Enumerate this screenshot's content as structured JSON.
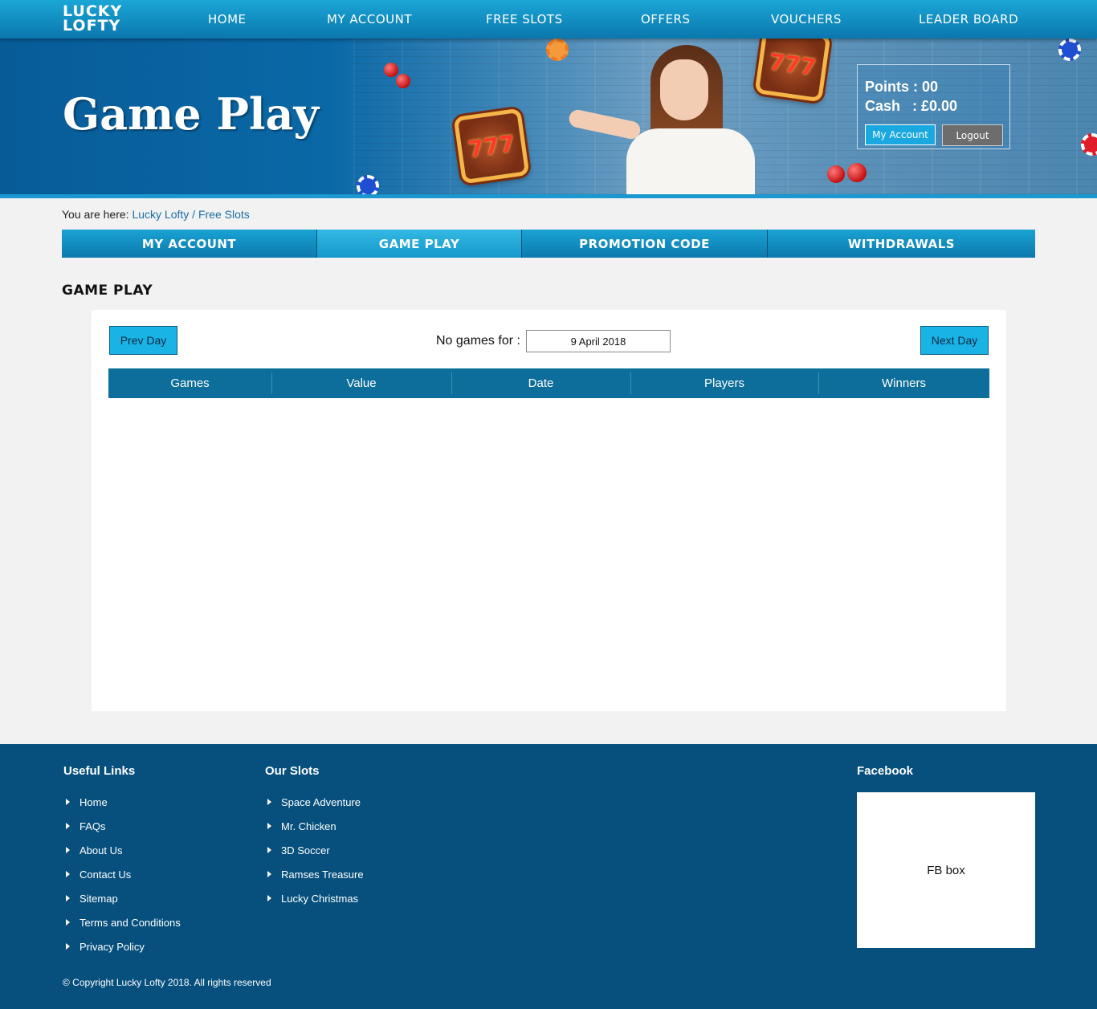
{
  "brand": {
    "logo_line1": "LUCKY",
    "logo_line2": "LOFTY"
  },
  "nav": [
    "HOME",
    "MY ACCOUNT",
    "FREE SLOTS",
    "OFFERS",
    "VOUCHERS",
    "LEADER BOARD"
  ],
  "hero": {
    "title": "Game Play",
    "slot_symbol": "777"
  },
  "account": {
    "points_label": "Points : 00",
    "cash_label": "Cash   : £0.00",
    "my_account_button": "My Account",
    "logout_button": "Logout"
  },
  "breadcrumb": {
    "prefix": "You are here:",
    "items": [
      "Lucky Lofty",
      "Free Slots"
    ],
    "separator": "/"
  },
  "subtabs": [
    {
      "label": "MY ACCOUNT",
      "active": false
    },
    {
      "label": "GAME PLAY",
      "active": true
    },
    {
      "label": "PROMOTION CODE",
      "active": false
    },
    {
      "label": "WITHDRAWALS",
      "active": false
    }
  ],
  "section_title": "GAME PLAY",
  "gameplay": {
    "prev_button": "Prev Day",
    "next_button": "Next Day",
    "no_games_label": "No games for :",
    "date_value": "9 April 2018",
    "columns": [
      "Games",
      "Value",
      "Date",
      "Players",
      "Winners"
    ]
  },
  "footer": {
    "useful_links_title": "Useful Links",
    "useful_links": [
      "Home",
      "FAQs",
      "About Us",
      "Contact Us",
      "Sitemap",
      "Terms and Conditions",
      "Privacy Policy"
    ],
    "our_slots_title": "Our Slots",
    "our_slots": [
      "Space Adventure",
      "Mr. Chicken",
      "3D Soccer",
      "Ramses Treasure",
      "Lucky Christmas"
    ],
    "facebook_title": "Facebook",
    "fb_box": "FB box",
    "copyright": "© Copyright Lucky Lofty 2018. All rights reserved"
  },
  "colors": {
    "nav_blue": "#0b77ad",
    "accent": "#1ab3e6",
    "table_head": "#0d6e9c",
    "footer": "#07507e"
  }
}
